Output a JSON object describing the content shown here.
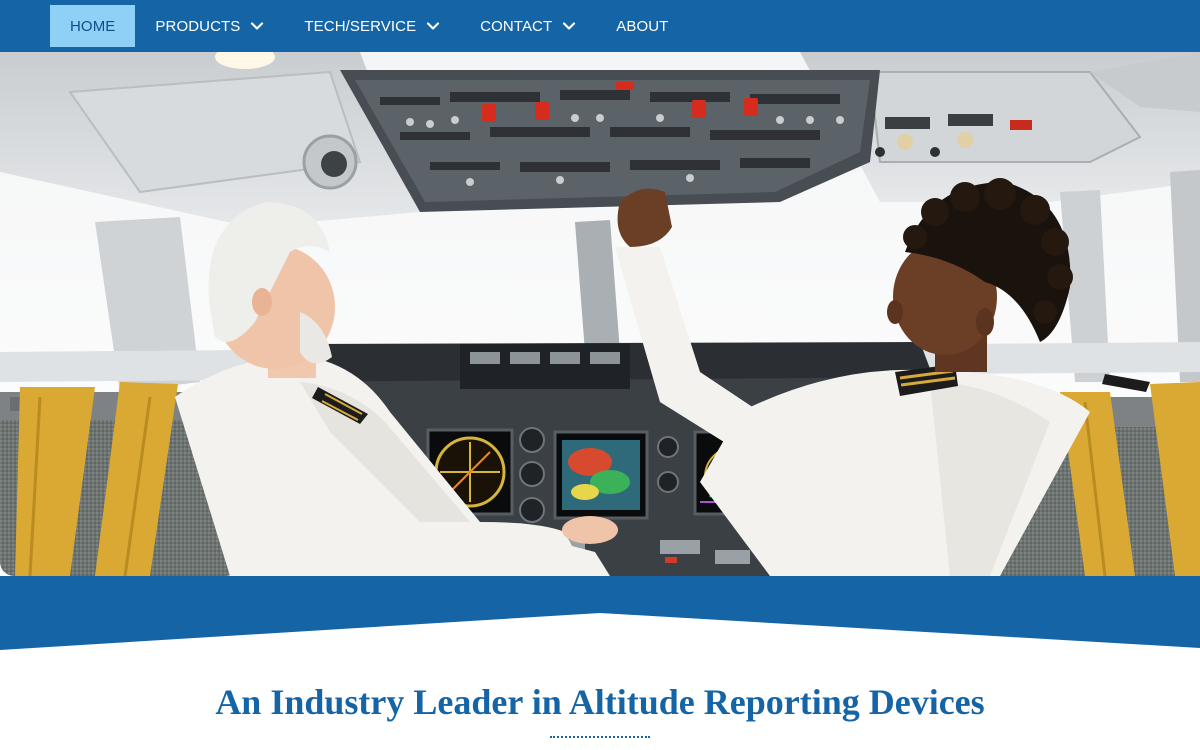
{
  "nav": {
    "items": [
      {
        "label": "HOME",
        "active": true,
        "has_dropdown": false
      },
      {
        "label": "PRODUCTS",
        "active": false,
        "has_dropdown": true
      },
      {
        "label": "TECH/SERVICE",
        "active": false,
        "has_dropdown": true
      },
      {
        "label": "CONTACT",
        "active": false,
        "has_dropdown": true
      },
      {
        "label": "ABOUT",
        "active": false,
        "has_dropdown": false
      }
    ]
  },
  "hero": {
    "image_alt": "Two pilots in an aircraft cockpit"
  },
  "main": {
    "headline": "An Industry Leader in Altitude Reporting Devices"
  },
  "colors": {
    "brand_blue": "#1565a6",
    "nav_active_bg": "#8fd0f7",
    "nav_active_text": "#0d4f8a",
    "nav_text": "#ffffff"
  }
}
